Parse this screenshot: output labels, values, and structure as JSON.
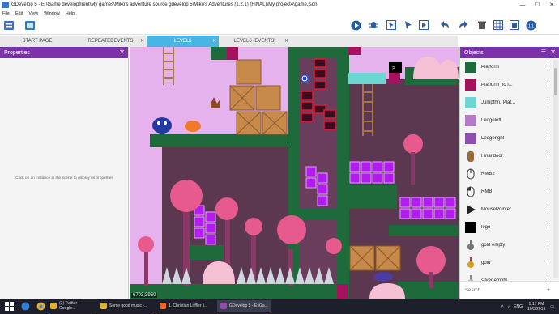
{
  "window": {
    "title": "GDevelop 5 - E:\\Game development\\My games\\Miko's adventure source gdevelop 5\\Miko's Adventures (1.2.1) (FINAL)\\My project4\\game.json",
    "min": "—",
    "max": "☐",
    "close": "✕"
  },
  "menu": [
    "File",
    "Edit",
    "View",
    "Window",
    "Help"
  ],
  "tabs": [
    {
      "label": "START PAGE",
      "close": ""
    },
    {
      "label": "REPEATEDEVENTS",
      "close": "✕"
    },
    {
      "label": "LEVEL6",
      "close": "✕"
    },
    {
      "label": "LEVEL6 (EVENTS)",
      "close": "✕"
    }
  ],
  "properties": {
    "title": "Properties",
    "hint": "Click on an instance in the scene to display its properties"
  },
  "scene": {
    "coords": "6703;3960"
  },
  "objects": {
    "title": "Objects",
    "items": [
      {
        "name": "Platform",
        "icon": "dark-green-square",
        "color": "#1e6a3a"
      },
      {
        "name": "Platform  no l...",
        "icon": "magenta-square",
        "color": "#a4125e"
      },
      {
        "name": "Jumpthru  Plat...",
        "icon": "cyan-square",
        "color": "#6ed6d0"
      },
      {
        "name": "Ledgeleft",
        "icon": "lilac-square",
        "color": "#b57ac8"
      },
      {
        "name": "Ledgeright",
        "icon": "purple-square",
        "color": "#8e4fb0"
      },
      {
        "name": "Final  door",
        "icon": "door-icon",
        "color": "#9a6a3b"
      },
      {
        "name": "RMB2",
        "icon": "mouse-icon",
        "color": "#333333"
      },
      {
        "name": "RMB",
        "icon": "mouse-icon",
        "color": "#333333"
      },
      {
        "name": "MousePointer",
        "icon": "arrow-icon",
        "color": "#222222"
      },
      {
        "name": "logo",
        "icon": "black-square",
        "color": "#000000"
      },
      {
        "name": "gold empty",
        "icon": "medal-icon",
        "color": "#777777"
      },
      {
        "name": "gold",
        "icon": "medal-icon",
        "color": "#d4a017"
      },
      {
        "name": "silver empty",
        "icon": "medal-icon",
        "color": "#888888"
      }
    ],
    "search_placeholder": "Search"
  },
  "taskbar": {
    "tasks": [
      "(3) Twitter - Google...",
      "Some good music -...",
      "1. Christian Löffler li...",
      "GDevelop 5 - E:\\Ga..."
    ],
    "lang": "ENG",
    "time": "9:17 PM",
    "date": "10/3/2019"
  },
  "colors": {
    "accent": "#7b32a8",
    "tab_active": "#4ab4e2",
    "taskbar": "#1d1f2a"
  }
}
